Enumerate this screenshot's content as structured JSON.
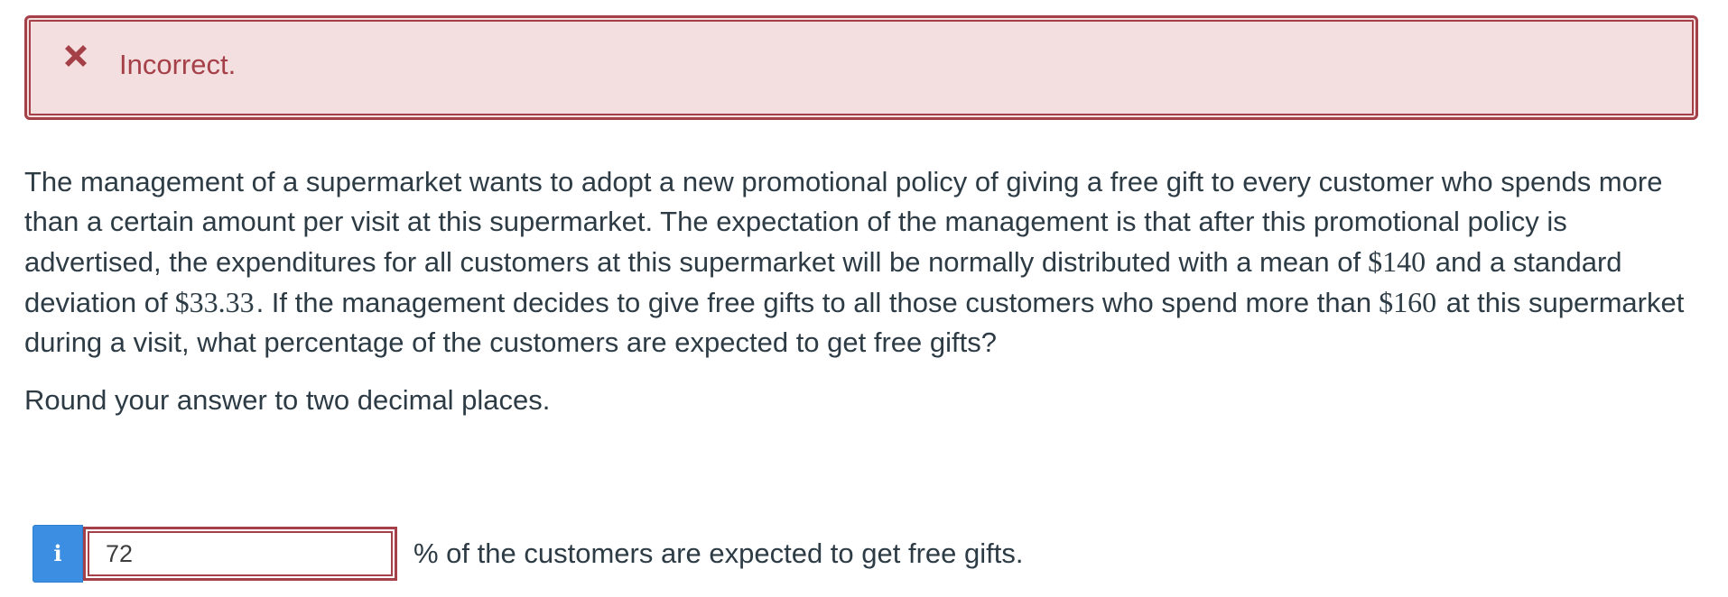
{
  "feedback": {
    "status": "Incorrect.",
    "icon": "close-icon",
    "color": "#a54049",
    "background": "#f3dfe0"
  },
  "question": {
    "text_1": "The management of a supermarket wants to adopt a new promotional policy of giving a free gift to every customer who spends more than a certain amount per visit at this supermarket. The expectation of the management is that after this promotional policy is advertised, the expenditures for all customers at this supermarket will be normally distributed with a mean of",
    "mean": "$140",
    "text_2": "and a standard deviation of",
    "std_dev": "$33.33",
    "text_3": ". If the management decides to give free gifts to all those customers who spend more than",
    "threshold": "$160",
    "text_4": "at this supermarket during a visit, what percentage of the customers are expected to get free gifts?"
  },
  "instruction": "Round your answer to two decimal places.",
  "answer": {
    "info_icon": "info-icon",
    "value": "72",
    "suffix": "% of the customers are expected to get free gifts."
  }
}
